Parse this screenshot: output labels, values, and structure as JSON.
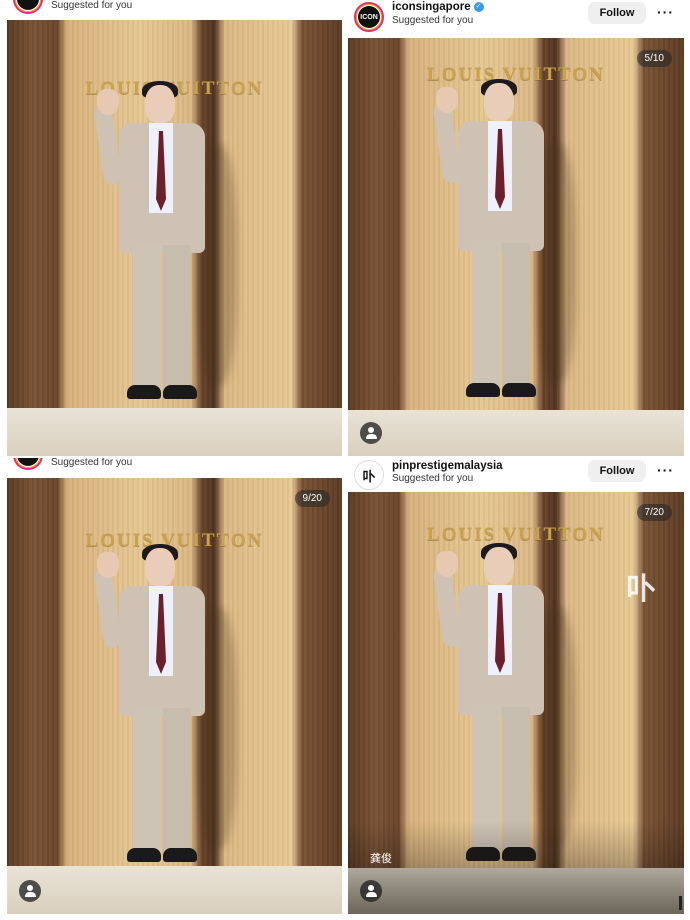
{
  "posts": [
    {
      "username": "",
      "subtitle": "Suggested for you",
      "brand": "LOUIS VUITTON",
      "counter": "",
      "caption": ""
    },
    {
      "username": "iconsingapore",
      "avatar_text": "ICON",
      "subtitle": "Suggested for you",
      "follow_label": "Follow",
      "more_icon": "···",
      "brand": "LOUIS VUITTON",
      "counter": "5/10",
      "caption": ""
    },
    {
      "username": "",
      "subtitle": "Suggested for you",
      "brand": "LOUIS VUITTON",
      "counter": "9/20",
      "caption": ""
    },
    {
      "username": "pinprestigemalaysia",
      "avatar_text": "卟",
      "subtitle": "Suggested for you",
      "follow_label": "Follow",
      "more_icon": "···",
      "brand": "LOUIS VUITTON",
      "counter": "7/20",
      "watermark": "卟",
      "caption": "龚俊"
    }
  ],
  "colors": {
    "verified": "#3897f0",
    "follow_bg": "#efefef",
    "brand_gold": "#c9a24c",
    "tie": "#6e1f2c",
    "suit": "#cdc2b3"
  }
}
